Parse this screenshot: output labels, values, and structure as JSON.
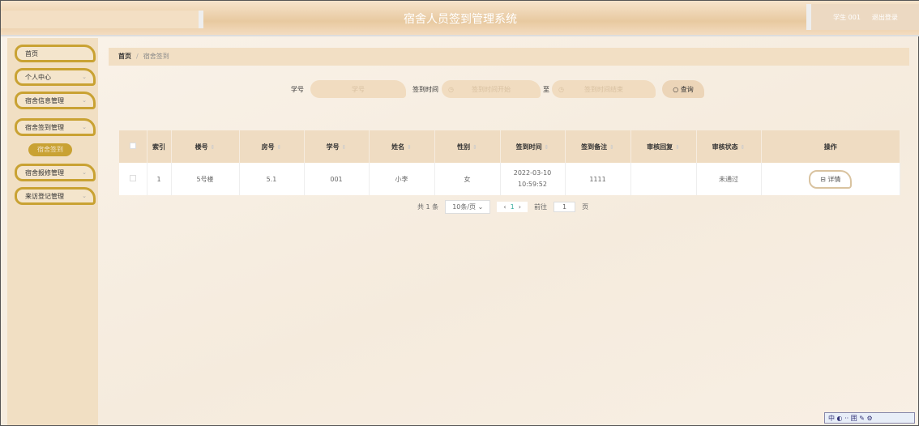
{
  "header": {
    "title": "宿舍人员签到管理系统",
    "user": "学生 001",
    "logout": "退出登录"
  },
  "sidebar": {
    "items": [
      {
        "label": "首页"
      },
      {
        "label": "个人中心"
      },
      {
        "label": "宿舍信息管理"
      },
      {
        "label": "宿舍签到管理"
      },
      {
        "label": "宿舍报修管理"
      },
      {
        "label": "来访登记管理"
      }
    ],
    "sub_item": "宿舍签到"
  },
  "breadcrumb": {
    "home": "首页",
    "current": "宿舍签到",
    "sep": "/"
  },
  "search": {
    "id_label": "学号",
    "id_placeholder": "学号",
    "time_label": "签到时间",
    "start_placeholder": "签到时间开始",
    "to": "至",
    "end_placeholder": "签到时间结束",
    "query": "查询"
  },
  "table": {
    "headers": [
      "索引",
      "楼号",
      "房号",
      "学号",
      "姓名",
      "性别",
      "签到时间",
      "签到备注",
      "审核回复",
      "审核状态",
      "操作"
    ],
    "rows": [
      {
        "index": "1",
        "building": "5号楼",
        "room": "5.1",
        "student_id": "001",
        "name": "小李",
        "gender": "女",
        "time": "2022-03-10 10:59:52",
        "note": "1111",
        "reply": "",
        "status": "未通过",
        "action": "详情"
      }
    ]
  },
  "pagination": {
    "total": "共 1 条",
    "page_size": "10条/页",
    "current": "1",
    "goto": "前往",
    "goto_value": "1",
    "page_suffix": "页"
  },
  "ime": {
    "label": "中 ◐ ·· 囲 ✎ ⚙"
  }
}
